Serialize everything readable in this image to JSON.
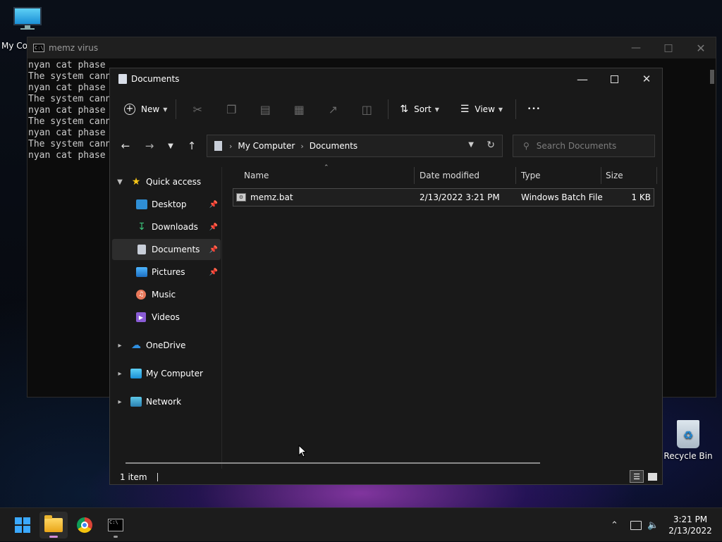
{
  "desktop": {
    "my_computer_label": "My Co",
    "recycle_bin_label": "Recycle Bin"
  },
  "console": {
    "title": "memz virus",
    "lines": [
      "nyan cat phase",
      "The system cann",
      "nyan cat phase",
      "The system cann",
      "nyan cat phase",
      "The system cann",
      "nyan cat phase",
      "The system cann",
      "nyan cat phase"
    ]
  },
  "explorer": {
    "title": "Documents",
    "toolbar": {
      "new_label": "New",
      "sort_label": "Sort",
      "view_label": "View",
      "more_label": "•••"
    },
    "address": {
      "crumbs": [
        "My Computer",
        "Documents"
      ]
    },
    "search": {
      "placeholder": "Search Documents"
    },
    "sidebar": {
      "quick_access": "Quick access",
      "items": [
        {
          "label": "Desktop",
          "icon": "desktop-icon",
          "pinned": true
        },
        {
          "label": "Downloads",
          "icon": "download-icon",
          "pinned": true
        },
        {
          "label": "Documents",
          "icon": "documents-icon",
          "pinned": true,
          "active": true
        },
        {
          "label": "Pictures",
          "icon": "pictures-icon",
          "pinned": true
        },
        {
          "label": "Music",
          "icon": "music-icon",
          "pinned": false
        },
        {
          "label": "Videos",
          "icon": "videos-icon",
          "pinned": false
        }
      ],
      "onedrive": "OneDrive",
      "my_computer": "My Computer",
      "network": "Network"
    },
    "columns": {
      "name": "Name",
      "date": "Date modified",
      "type": "Type",
      "size": "Size"
    },
    "files": [
      {
        "name": "memz.bat",
        "date": "2/13/2022 3:21 PM",
        "type": "Windows Batch File",
        "size": "1 KB"
      }
    ],
    "status": {
      "count": "1 item"
    }
  },
  "taskbar": {
    "time": "3:21 PM",
    "date": "2/13/2022"
  },
  "colors": {
    "accent": "#3ba9ff",
    "explorer_bg": "#191919",
    "console_bg": "#0c0c0c"
  }
}
